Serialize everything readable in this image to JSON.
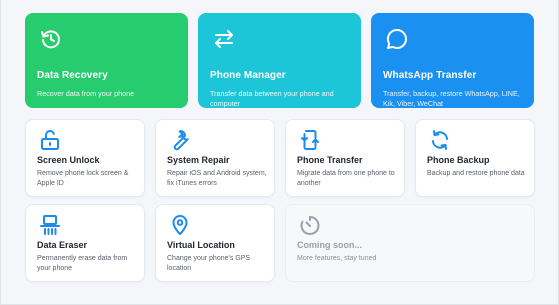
{
  "colors": {
    "data_recovery_bg": "#27cc6e",
    "phone_manager_bg": "#1cc6d8",
    "whatsapp_transfer_bg": "#1a91f0",
    "icon_blue": "#1a8cf0",
    "icon_gray": "#9aa0ab"
  },
  "featured": [
    {
      "title": "Data Recovery",
      "desc": "Recover data from your phone",
      "icon": "clock-restore-icon"
    },
    {
      "title": "Phone Manager",
      "desc": "Transfer data between your phone and computer",
      "icon": "swap-arrows-icon"
    },
    {
      "title": "WhatsApp Transfer",
      "desc": "Transfer, backup, restore WhatsApp, LINE, Kik, Viber, WeChat",
      "icon": "chat-bubble-icon"
    }
  ],
  "tools": [
    {
      "title": "Screen Unlock",
      "desc": "Remove phone lock screen & Apple ID",
      "icon": "unlock-icon"
    },
    {
      "title": "System Repair",
      "desc": "Repair iOS and Android system, fix iTunes errors",
      "icon": "wrench-icon"
    },
    {
      "title": "Phone Transfer",
      "desc": "Migrate data from one phone to another",
      "icon": "phone-transfer-icon"
    },
    {
      "title": "Phone Backup",
      "desc": "Backup and restore phone data",
      "icon": "sync-icon"
    },
    {
      "title": "Data Eraser",
      "desc": "Permanently erase data from your phone",
      "icon": "shredder-icon"
    },
    {
      "title": "Virtual Location",
      "desc": "Change your phone's GPS location",
      "icon": "map-pin-icon"
    }
  ],
  "coming_soon": {
    "title": "Coming soon...",
    "desc": "More features, stay tuned",
    "icon": "timer-icon"
  }
}
